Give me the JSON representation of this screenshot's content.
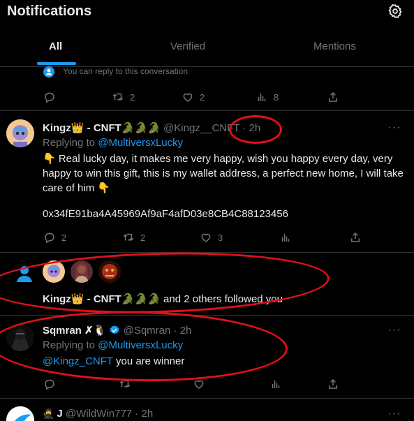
{
  "header": {
    "title": "Notifications",
    "tabs": [
      {
        "label": "All"
      },
      {
        "label": "Verified"
      },
      {
        "label": "Mentions"
      }
    ]
  },
  "reply_notice": "You can reply to this conversation",
  "top_actions": {
    "retweets": "2",
    "likes": "2",
    "views": "8"
  },
  "tweet1": {
    "name": "Kingz👑 - CNFT🐊🐊🐊",
    "handle": "@Kingz__CNFT",
    "time": "· 2h",
    "replying_prefix": "Replying to",
    "replying_to": "@MultiversxLucky",
    "text": "👇 Real lucky day, it makes me very happy, wish you happy every day, very happy to win this gift, this is my wallet address, a perfect new home, I will take care of him 👇",
    "wallet": "0x34fE91ba4A45969Af9aF4afD03e8CB4C88123456",
    "replies": "2",
    "retweets": "2",
    "likes": "3"
  },
  "follow": {
    "name": "Kingz👑 - CNFT🐊🐊🐊",
    "text": " and 2 others followed you"
  },
  "tweet2": {
    "name": "Sqmran ✗🐧",
    "handle": "@Sqmran",
    "time": "· 2h",
    "replying_prefix": "Replying to",
    "replying_to": "@MultiversxLucky",
    "mention": "@Kingz_CNFT",
    "text": " you are winner"
  },
  "tweet3": {
    "name": "J",
    "handle": "@WildWin777",
    "time": "· 2h"
  },
  "colors": {
    "accent": "#1d9bf0",
    "annotation": "#e0101b",
    "muted": "#71767b"
  }
}
